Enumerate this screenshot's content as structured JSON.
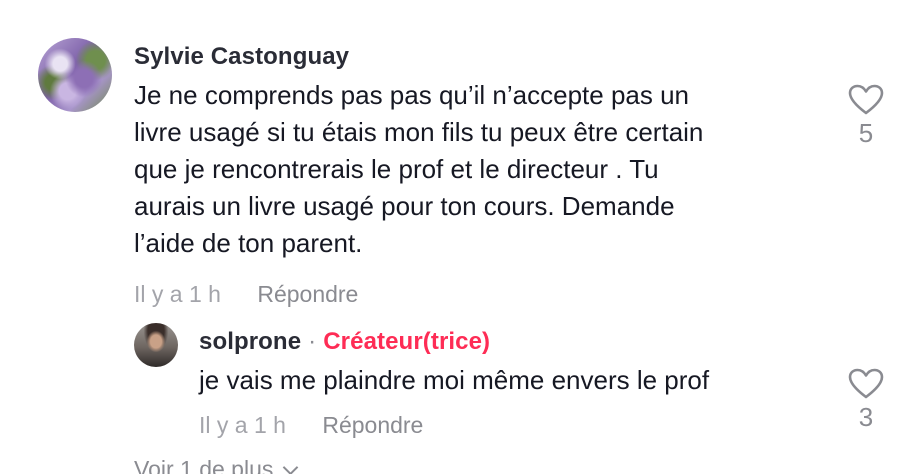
{
  "comment": {
    "author": "Sylvie Castonguay",
    "lines": [
      "Je ne comprends pas pas qu’il n’accepte pas un",
      "livre usagé si tu étais mon fils tu peux être certain",
      "que je rencontrerais le prof et le directeur . Tu",
      "aurais un livre usagé pour ton cours. Demande",
      "l’aide de ton parent."
    ],
    "time": "Il y a 1 h",
    "reply_label": "Répondre",
    "like_count": "5"
  },
  "reply": {
    "author": "solprone",
    "separator": "·",
    "creator_badge": "Créateur(trice)",
    "text": "je vais me plaindre moi même envers le prof",
    "time": "Il y a 1 h",
    "reply_label": "Répondre",
    "like_count": "3"
  },
  "view_more": {
    "label": "Voir 1 de plus"
  },
  "colors": {
    "creator_badge": "#fe2c55",
    "text": "#161823",
    "muted": "#8a8b91"
  },
  "icons": {
    "like": "heart-outline-icon",
    "expand": "chevron-down-icon"
  }
}
